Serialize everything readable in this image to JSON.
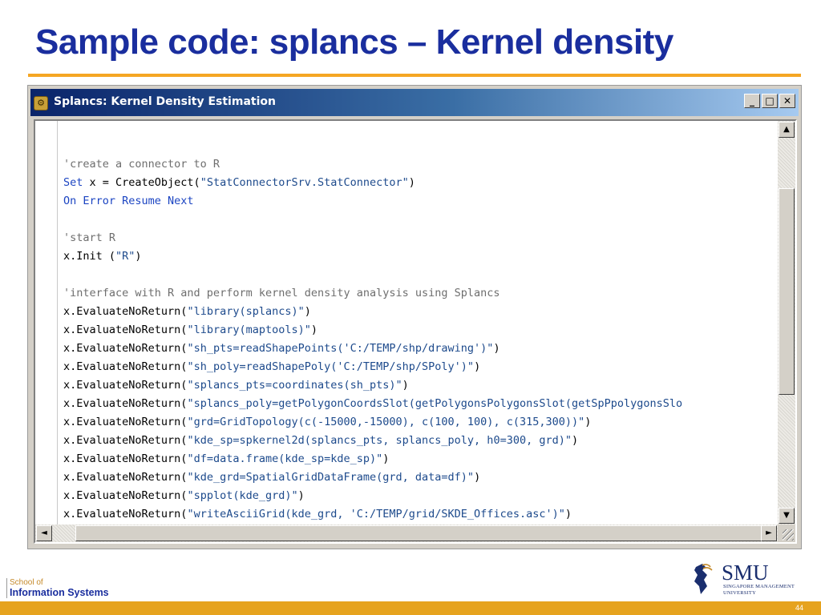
{
  "slide": {
    "title": "Sample code: splancs – Kernel density",
    "page_number": "44"
  },
  "window": {
    "title": "Splancs: Kernel Density Estimation",
    "icon": "gear-app-icon",
    "buttons": {
      "minimize": "_",
      "maximize": "□",
      "close": "✕"
    }
  },
  "code_lines": [
    {
      "kind": "blank",
      "text": ""
    },
    {
      "kind": "comment",
      "text": "'create a connector to R"
    },
    {
      "kind": "mixed",
      "parts": [
        [
          "k",
          "Set "
        ],
        [
          "d",
          "x = CreateObject("
        ],
        [
          "s",
          "\"StatConnectorSrv.StatConnector\""
        ],
        [
          "d",
          ")"
        ]
      ]
    },
    {
      "kind": "keyword",
      "text": "On Error Resume Next"
    },
    {
      "kind": "blank",
      "text": ""
    },
    {
      "kind": "comment",
      "text": "'start R"
    },
    {
      "kind": "mixed",
      "parts": [
        [
          "d",
          "x.Init ("
        ],
        [
          "s",
          "\"R\""
        ],
        [
          "d",
          ")"
        ]
      ]
    },
    {
      "kind": "blank",
      "text": ""
    },
    {
      "kind": "comment",
      "text": "'interface with R and perform kernel density analysis using Splancs"
    },
    {
      "kind": "mixed",
      "parts": [
        [
          "d",
          "x.EvaluateNoReturn("
        ],
        [
          "s",
          "\"library(splancs)\""
        ],
        [
          "d",
          ")"
        ]
      ]
    },
    {
      "kind": "mixed",
      "parts": [
        [
          "d",
          "x.EvaluateNoReturn("
        ],
        [
          "s",
          "\"library(maptools)\""
        ],
        [
          "d",
          ")"
        ]
      ]
    },
    {
      "kind": "mixed",
      "parts": [
        [
          "d",
          "x.EvaluateNoReturn("
        ],
        [
          "s",
          "\"sh_pts=readShapePoints('C:/TEMP/shp/drawing')\""
        ],
        [
          "d",
          ")"
        ]
      ]
    },
    {
      "kind": "mixed",
      "parts": [
        [
          "d",
          "x.EvaluateNoReturn("
        ],
        [
          "s",
          "\"sh_poly=readShapePoly('C:/TEMP/shp/SPoly')\""
        ],
        [
          "d",
          ")"
        ]
      ]
    },
    {
      "kind": "mixed",
      "parts": [
        [
          "d",
          "x.EvaluateNoReturn("
        ],
        [
          "s",
          "\"splancs_pts=coordinates(sh_pts)\""
        ],
        [
          "d",
          ")"
        ]
      ]
    },
    {
      "kind": "mixed",
      "parts": [
        [
          "d",
          "x.EvaluateNoReturn("
        ],
        [
          "s",
          "\"splancs_poly=getPolygonCoordsSlot(getPolygonsPolygonsSlot(getSpPpolygonsSlo"
        ]
      ]
    },
    {
      "kind": "mixed",
      "parts": [
        [
          "d",
          "x.EvaluateNoReturn("
        ],
        [
          "s",
          "\"grd=GridTopology(c(-15000,-15000), c(100, 100), c(315,300))\""
        ],
        [
          "d",
          ")"
        ]
      ]
    },
    {
      "kind": "mixed",
      "parts": [
        [
          "d",
          "x.EvaluateNoReturn("
        ],
        [
          "s",
          "\"kde_sp=spkernel2d(splancs_pts, splancs_poly, h0=300, grd)\""
        ],
        [
          "d",
          ")"
        ]
      ]
    },
    {
      "kind": "mixed",
      "parts": [
        [
          "d",
          "x.EvaluateNoReturn("
        ],
        [
          "s",
          "\"df=data.frame(kde_sp=kde_sp)\""
        ],
        [
          "d",
          ")"
        ]
      ]
    },
    {
      "kind": "mixed",
      "parts": [
        [
          "d",
          "x.EvaluateNoReturn("
        ],
        [
          "s",
          "\"kde_grd=SpatialGridDataFrame(grd, data=df)\""
        ],
        [
          "d",
          ")"
        ]
      ]
    },
    {
      "kind": "mixed",
      "parts": [
        [
          "d",
          "x.EvaluateNoReturn("
        ],
        [
          "s",
          "\"spplot(kde_grd)\""
        ],
        [
          "d",
          ")"
        ]
      ]
    },
    {
      "kind": "mixed",
      "parts": [
        [
          "d",
          "x.EvaluateNoReturn("
        ],
        [
          "s",
          "\"writeAsciiGrid(kde_grd, 'C:/TEMP/grid/SKDE_Offices.asc')\""
        ],
        [
          "d",
          ")"
        ]
      ]
    }
  ],
  "scrollbars": {
    "up": "▲",
    "down": "▼",
    "left": "◄",
    "right": "►"
  },
  "footer": {
    "school_line1": "School of",
    "school_line2": "Information Systems",
    "logo_name": "SMU",
    "logo_sub_line1": "SINGAPORE MANAGEMENT",
    "logo_sub_line2": "UNIVERSITY"
  },
  "colors": {
    "title": "#1a2e9e",
    "accent_rule": "#f5a623",
    "footer_bar": "#e6a31e",
    "code_comment": "#6e6e6e",
    "code_keyword": "#1b44c2",
    "code_string": "#1d4a8c"
  }
}
